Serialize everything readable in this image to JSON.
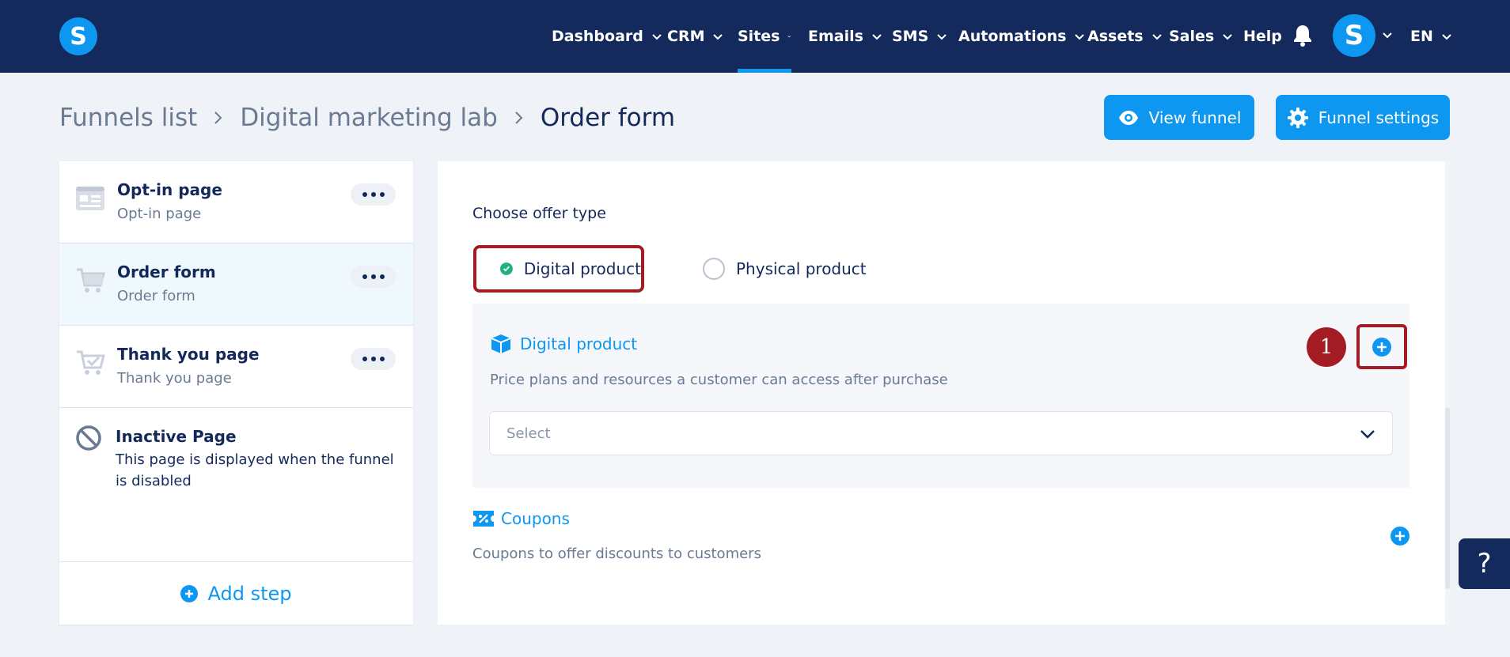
{
  "app": {
    "logo_letter": "S"
  },
  "nav": {
    "items": [
      {
        "label": "Dashboard"
      },
      {
        "label": "CRM"
      },
      {
        "label": "Sites"
      },
      {
        "label": "Emails"
      },
      {
        "label": "SMS"
      },
      {
        "label": "Automations"
      },
      {
        "label": "Assets"
      },
      {
        "label": "Sales"
      }
    ],
    "help_label": "Help",
    "avatar_letter": "S",
    "language": "EN",
    "active": "Sites"
  },
  "breadcrumb": {
    "items": [
      "Funnels list",
      "Digital marketing lab",
      "Order form"
    ]
  },
  "header_buttons": {
    "view_funnel": "View funnel",
    "funnel_settings": "Funnel settings"
  },
  "steps": {
    "items": [
      {
        "title": "Opt-in page",
        "subtitle": "Opt-in page",
        "icon": "optin-page-icon"
      },
      {
        "title": "Order form",
        "subtitle": "Order form",
        "icon": "cart-icon",
        "active": true
      },
      {
        "title": "Thank you page",
        "subtitle": "Thank you page",
        "icon": "cart-check-icon"
      }
    ],
    "inactive": {
      "title": "Inactive Page",
      "description": "This page is displayed when the funnel is disabled"
    },
    "add_step_label": "Add step"
  },
  "offer": {
    "label": "Choose offer type",
    "options": [
      {
        "label": "Digital product",
        "selected": true
      },
      {
        "label": "Physical product",
        "selected": false
      }
    ]
  },
  "digital_product": {
    "title": "Digital product",
    "description": "Price plans and resources a customer can access after purchase",
    "select_placeholder": "Select",
    "annotation_number": "1"
  },
  "coupons": {
    "title": "Coupons",
    "description": "Coupons to offer discounts to customers"
  },
  "help_widget": {
    "label": "?"
  },
  "colors": {
    "nav_bg": "#14295c",
    "accent": "#0d97f0",
    "highlight": "#a31c23",
    "success": "#20b27a",
    "page_bg": "#eff3f8"
  }
}
